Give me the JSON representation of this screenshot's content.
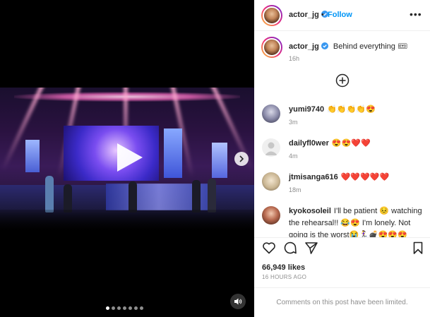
{
  "post": {
    "username": "actor_jg",
    "follow_label": "Follow",
    "bullet": "•",
    "more": "•••",
    "caption_text": "Behind everything 🎟",
    "caption_time": "16h",
    "likes": "66,949 likes",
    "time_ago": "16 HOURS AGO",
    "comments_limited": "Comments on this post have been limited."
  },
  "media": {
    "carousel_count": 7,
    "active_index": 0
  },
  "comments": [
    {
      "user": "yumi9740",
      "text": "👏👏👏👏😍",
      "time": "3m"
    },
    {
      "user": "dailyfl0wer",
      "text": "😍😍❤️❤️",
      "time": "4m"
    },
    {
      "user": "jtmisanga616",
      "text": "❤️❤️❤️❤️❤️",
      "time": "18m"
    },
    {
      "user": "kyokosoleil",
      "text": "I'll be patient 😣 watching the rehearsal!! 😂😍 I'm lonely. Not going is the worst😭🏃‍♀️💣😍😍😍",
      "time": ""
    }
  ],
  "colors": {
    "accent": "#0095f6",
    "verified": "#3897f0",
    "muted": "#8e8e8e",
    "heart": "#ed4956"
  },
  "icons": [
    "verified-badge-icon",
    "more-options-icon",
    "add-comment-icon",
    "heart-icon",
    "comment-icon",
    "share-icon",
    "bookmark-icon",
    "play-icon",
    "chevron-right-icon",
    "speaker-icon"
  ]
}
